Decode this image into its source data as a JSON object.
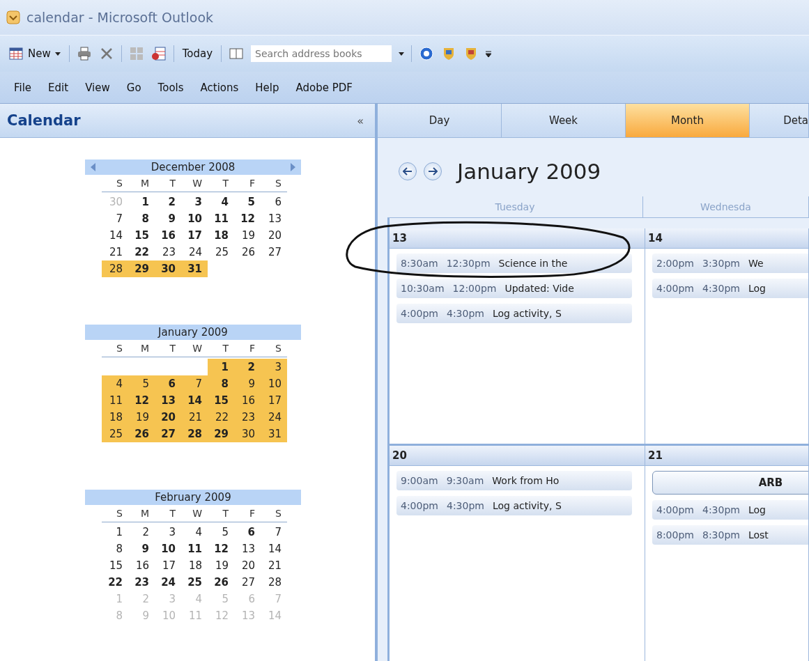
{
  "window": {
    "title": "calendar - Microsoft Outlook"
  },
  "toolbar": {
    "new_label": "New",
    "today_label": "Today",
    "search": {
      "placeholder": "Search address books"
    }
  },
  "menu": [
    "File",
    "Edit",
    "View",
    "Go",
    "Tools",
    "Actions",
    "Help",
    "Adobe PDF"
  ],
  "navigation_pane": {
    "title": "Calendar",
    "collapse": "«"
  },
  "mini_calendars": [
    {
      "title": "December 2008",
      "arrows": true,
      "weekday_letters": [
        "S",
        "M",
        "T",
        "W",
        "T",
        "F",
        "S"
      ],
      "weeks": [
        [
          {
            "d": "30",
            "bold": false,
            "muted": true,
            "selected": false
          },
          {
            "d": "1",
            "bold": true,
            "muted": false,
            "selected": false
          },
          {
            "d": "2",
            "bold": true,
            "muted": false,
            "selected": false
          },
          {
            "d": "3",
            "bold": true,
            "muted": false,
            "selected": false
          },
          {
            "d": "4",
            "bold": true,
            "muted": false,
            "selected": false
          },
          {
            "d": "5",
            "bold": true,
            "muted": false,
            "selected": false
          },
          {
            "d": "6",
            "bold": false,
            "muted": false,
            "selected": false
          }
        ],
        [
          {
            "d": "7",
            "bold": false,
            "muted": false,
            "selected": false
          },
          {
            "d": "8",
            "bold": true,
            "muted": false,
            "selected": false
          },
          {
            "d": "9",
            "bold": true,
            "muted": false,
            "selected": false
          },
          {
            "d": "10",
            "bold": true,
            "muted": false,
            "selected": false
          },
          {
            "d": "11",
            "bold": true,
            "muted": false,
            "selected": false
          },
          {
            "d": "12",
            "bold": true,
            "muted": false,
            "selected": false
          },
          {
            "d": "13",
            "bold": false,
            "muted": false,
            "selected": false
          }
        ],
        [
          {
            "d": "14",
            "bold": false,
            "muted": false,
            "selected": false
          },
          {
            "d": "15",
            "bold": true,
            "muted": false,
            "selected": false
          },
          {
            "d": "16",
            "bold": true,
            "muted": false,
            "selected": false
          },
          {
            "d": "17",
            "bold": true,
            "muted": false,
            "selected": false
          },
          {
            "d": "18",
            "bold": true,
            "muted": false,
            "selected": false
          },
          {
            "d": "19",
            "bold": false,
            "muted": false,
            "selected": false
          },
          {
            "d": "20",
            "bold": false,
            "muted": false,
            "selected": false
          }
        ],
        [
          {
            "d": "21",
            "bold": false,
            "muted": false,
            "selected": false
          },
          {
            "d": "22",
            "bold": true,
            "muted": false,
            "selected": false
          },
          {
            "d": "23",
            "bold": false,
            "muted": false,
            "selected": false
          },
          {
            "d": "24",
            "bold": false,
            "muted": false,
            "selected": false
          },
          {
            "d": "25",
            "bold": false,
            "muted": false,
            "selected": false
          },
          {
            "d": "26",
            "bold": false,
            "muted": false,
            "selected": false
          },
          {
            "d": "27",
            "bold": false,
            "muted": false,
            "selected": false
          }
        ],
        [
          {
            "d": "28",
            "bold": false,
            "muted": false,
            "selected": true
          },
          {
            "d": "29",
            "bold": true,
            "muted": false,
            "selected": true
          },
          {
            "d": "30",
            "bold": true,
            "muted": false,
            "selected": true
          },
          {
            "d": "31",
            "bold": true,
            "muted": false,
            "selected": true
          }
        ]
      ]
    },
    {
      "title": "January 2009",
      "arrows": false,
      "weekday_letters": [
        "S",
        "M",
        "T",
        "W",
        "T",
        "F",
        "S"
      ],
      "weeks": [
        [
          {
            "d": "1",
            "bold": true,
            "muted": false,
            "selected": true
          },
          {
            "d": "2",
            "bold": true,
            "muted": false,
            "selected": true
          },
          {
            "d": "3",
            "bold": false,
            "muted": false,
            "selected": true
          }
        ],
        [
          {
            "d": "4",
            "bold": false,
            "muted": false,
            "selected": true
          },
          {
            "d": "5",
            "bold": false,
            "muted": false,
            "selected": true
          },
          {
            "d": "6",
            "bold": true,
            "muted": false,
            "selected": true
          },
          {
            "d": "7",
            "bold": false,
            "muted": false,
            "selected": true
          },
          {
            "d": "8",
            "bold": true,
            "muted": false,
            "selected": true
          },
          {
            "d": "9",
            "bold": false,
            "muted": false,
            "selected": true
          },
          {
            "d": "10",
            "bold": false,
            "muted": false,
            "selected": true
          }
        ],
        [
          {
            "d": "11",
            "bold": false,
            "muted": false,
            "selected": true
          },
          {
            "d": "12",
            "bold": true,
            "muted": false,
            "selected": true
          },
          {
            "d": "13",
            "bold": true,
            "muted": false,
            "selected": true
          },
          {
            "d": "14",
            "bold": true,
            "muted": false,
            "selected": true
          },
          {
            "d": "15",
            "bold": true,
            "muted": false,
            "selected": true
          },
          {
            "d": "16",
            "bold": false,
            "muted": false,
            "selected": true
          },
          {
            "d": "17",
            "bold": false,
            "muted": false,
            "selected": true
          }
        ],
        [
          {
            "d": "18",
            "bold": false,
            "muted": false,
            "selected": true
          },
          {
            "d": "19",
            "bold": false,
            "muted": false,
            "selected": true
          },
          {
            "d": "20",
            "bold": true,
            "muted": false,
            "selected": true
          },
          {
            "d": "21",
            "bold": false,
            "muted": false,
            "selected": true
          },
          {
            "d": "22",
            "bold": false,
            "muted": false,
            "selected": true
          },
          {
            "d": "23",
            "bold": false,
            "muted": false,
            "selected": true
          },
          {
            "d": "24",
            "bold": false,
            "muted": false,
            "selected": true
          }
        ],
        [
          {
            "d": "25",
            "bold": false,
            "muted": false,
            "selected": true
          },
          {
            "d": "26",
            "bold": true,
            "muted": false,
            "selected": true
          },
          {
            "d": "27",
            "bold": true,
            "muted": false,
            "selected": true
          },
          {
            "d": "28",
            "bold": true,
            "muted": false,
            "selected": true
          },
          {
            "d": "29",
            "bold": true,
            "muted": false,
            "selected": true
          },
          {
            "d": "30",
            "bold": false,
            "muted": false,
            "selected": true
          },
          {
            "d": "31",
            "bold": false,
            "muted": false,
            "selected": true
          }
        ]
      ]
    },
    {
      "title": "February 2009",
      "arrows": false,
      "weekday_letters": [
        "S",
        "M",
        "T",
        "W",
        "T",
        "F",
        "S"
      ],
      "weeks": [
        [
          {
            "d": "1",
            "bold": false,
            "muted": false,
            "selected": false
          },
          {
            "d": "2",
            "bold": false,
            "muted": false,
            "selected": false
          },
          {
            "d": "3",
            "bold": false,
            "muted": false,
            "selected": false
          },
          {
            "d": "4",
            "bold": false,
            "muted": false,
            "selected": false
          },
          {
            "d": "5",
            "bold": false,
            "muted": false,
            "selected": false
          },
          {
            "d": "6",
            "bold": true,
            "muted": false,
            "selected": false
          },
          {
            "d": "7",
            "bold": false,
            "muted": false,
            "selected": false
          }
        ],
        [
          {
            "d": "8",
            "bold": false,
            "muted": false,
            "selected": false
          },
          {
            "d": "9",
            "bold": true,
            "muted": false,
            "selected": false
          },
          {
            "d": "10",
            "bold": true,
            "muted": false,
            "selected": false
          },
          {
            "d": "11",
            "bold": true,
            "muted": false,
            "selected": false
          },
          {
            "d": "12",
            "bold": true,
            "muted": false,
            "selected": false
          },
          {
            "d": "13",
            "bold": false,
            "muted": false,
            "selected": false
          },
          {
            "d": "14",
            "bold": false,
            "muted": false,
            "selected": false
          }
        ],
        [
          {
            "d": "15",
            "bold": false,
            "muted": false,
            "selected": false
          },
          {
            "d": "16",
            "bold": false,
            "muted": false,
            "selected": false
          },
          {
            "d": "17",
            "bold": false,
            "muted": false,
            "selected": false
          },
          {
            "d": "18",
            "bold": false,
            "muted": false,
            "selected": false
          },
          {
            "d": "19",
            "bold": false,
            "muted": false,
            "selected": false
          },
          {
            "d": "20",
            "bold": false,
            "muted": false,
            "selected": false
          },
          {
            "d": "21",
            "bold": false,
            "muted": false,
            "selected": false
          }
        ],
        [
          {
            "d": "22",
            "bold": true,
            "muted": false,
            "selected": false
          },
          {
            "d": "23",
            "bold": true,
            "muted": false,
            "selected": false
          },
          {
            "d": "24",
            "bold": true,
            "muted": false,
            "selected": false
          },
          {
            "d": "25",
            "bold": true,
            "muted": false,
            "selected": false
          },
          {
            "d": "26",
            "bold": true,
            "muted": false,
            "selected": false
          },
          {
            "d": "27",
            "bold": false,
            "muted": false,
            "selected": false
          },
          {
            "d": "28",
            "bold": false,
            "muted": false,
            "selected": false
          }
        ],
        [
          {
            "d": "1",
            "bold": false,
            "muted": true,
            "selected": false
          },
          {
            "d": "2",
            "bold": false,
            "muted": true,
            "selected": false
          },
          {
            "d": "3",
            "bold": false,
            "muted": true,
            "selected": false
          },
          {
            "d": "4",
            "bold": false,
            "muted": true,
            "selected": false
          },
          {
            "d": "5",
            "bold": false,
            "muted": true,
            "selected": false
          },
          {
            "d": "6",
            "bold": false,
            "muted": true,
            "selected": false
          },
          {
            "d": "7",
            "bold": false,
            "muted": true,
            "selected": false
          }
        ],
        [
          {
            "d": "8",
            "bold": false,
            "muted": true,
            "selected": false
          },
          {
            "d": "9",
            "bold": false,
            "muted": true,
            "selected": false
          },
          {
            "d": "10",
            "bold": false,
            "muted": true,
            "selected": false
          },
          {
            "d": "11",
            "bold": false,
            "muted": true,
            "selected": false
          },
          {
            "d": "12",
            "bold": false,
            "muted": true,
            "selected": false
          },
          {
            "d": "13",
            "bold": false,
            "muted": true,
            "selected": false
          },
          {
            "d": "14",
            "bold": false,
            "muted": true,
            "selected": false
          }
        ]
      ]
    }
  ],
  "view_tabs": [
    {
      "label": "Day",
      "selected": false
    },
    {
      "label": "Week",
      "selected": false
    },
    {
      "label": "Month",
      "selected": true
    },
    {
      "label": "Deta",
      "selected": false
    }
  ],
  "month_title": "January 2009",
  "day_names": [
    "Tuesday",
    "Wednesda"
  ],
  "weeks": [
    {
      "days": [
        {
          "date": "13",
          "items": [
            {
              "kind": "appointment",
              "start": "8:30am",
              "end": "12:30pm",
              "subject": "Science in the"
            },
            {
              "kind": "appointment",
              "start": "10:30am",
              "end": "12:00pm",
              "subject": "Updated: Vide"
            },
            {
              "kind": "appointment",
              "start": "4:00pm",
              "end": "4:30pm",
              "subject": "Log activity, S"
            }
          ]
        },
        {
          "date": "14",
          "items": [
            {
              "kind": "appointment",
              "start": "2:00pm",
              "end": "3:30pm",
              "subject": "We"
            },
            {
              "kind": "appointment",
              "start": "4:00pm",
              "end": "4:30pm",
              "subject": "Log"
            }
          ]
        }
      ]
    },
    {
      "days": [
        {
          "date": "20",
          "items": [
            {
              "kind": "appointment",
              "start": "9:00am",
              "end": "9:30am",
              "subject": "Work from Ho"
            },
            {
              "kind": "appointment",
              "start": "4:00pm",
              "end": "4:30pm",
              "subject": "Log activity, S"
            }
          ]
        },
        {
          "date": "21",
          "items": [
            {
              "kind": "all_day",
              "subject": "ARB"
            },
            {
              "kind": "appointment",
              "start": "4:00pm",
              "end": "4:30pm",
              "subject": "Log"
            },
            {
              "kind": "appointment",
              "start": "8:00pm",
              "end": "8:30pm",
              "subject": "Lost"
            }
          ]
        }
      ]
    }
  ]
}
